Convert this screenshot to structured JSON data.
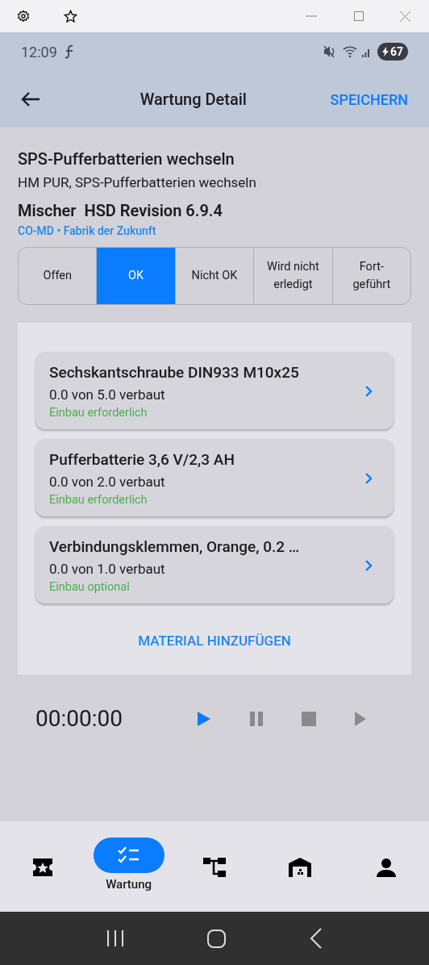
{
  "status_bar": {
    "time": "12:09",
    "battery": "67"
  },
  "app_bar": {
    "title": "Wartung Detail",
    "action": "SPEICHERN"
  },
  "task": {
    "title": "SPS-Pufferbatterien wechseln",
    "subtitle": "HM PUR, SPS-Pufferbatterien wechseln",
    "machine": "Mischer  HSD Revision 6.9.4",
    "location": "CO-MD • Fabrik der Zukunft"
  },
  "status_tabs": [
    {
      "label": "Offen",
      "selected": false
    },
    {
      "label": "OK",
      "selected": true
    },
    {
      "label": "Nicht OK",
      "selected": false
    },
    {
      "label": "Wird nicht erledigt",
      "selected": false
    },
    {
      "label": "Fort-\ngeführt",
      "selected": false
    }
  ],
  "materials": [
    {
      "name": "Sechskantschraube DIN933 M10x25",
      "amount": "0.0 von 5.0 verbaut",
      "requirement": "Einbau erforderlich"
    },
    {
      "name": "Pufferbatterie 3,6 V/2,3 AH",
      "amount": "0.0 von 2.0 verbaut",
      "requirement": "Einbau erforderlich"
    },
    {
      "name": "Verbindungsklemmen, Orange, 0.2 …",
      "amount": "0.0 von 1.0 verbaut",
      "requirement": "Einbau optional"
    }
  ],
  "add_material": "MATERIAL HINZUFÜGEN",
  "timer": {
    "time": "00:00:00",
    "controls": [
      {
        "kind": "play",
        "disabled": false
      },
      {
        "kind": "pause",
        "disabled": true
      },
      {
        "kind": "stop",
        "disabled": true
      },
      {
        "kind": "resume",
        "disabled": true
      }
    ]
  },
  "bottom_nav": [
    {
      "kind": "ticket",
      "selected": false
    },
    {
      "kind": "checklist",
      "label": "Wartung",
      "selected": true
    },
    {
      "kind": "hierarchy",
      "selected": false
    },
    {
      "kind": "warehouse",
      "selected": false
    },
    {
      "kind": "person",
      "selected": false
    }
  ]
}
